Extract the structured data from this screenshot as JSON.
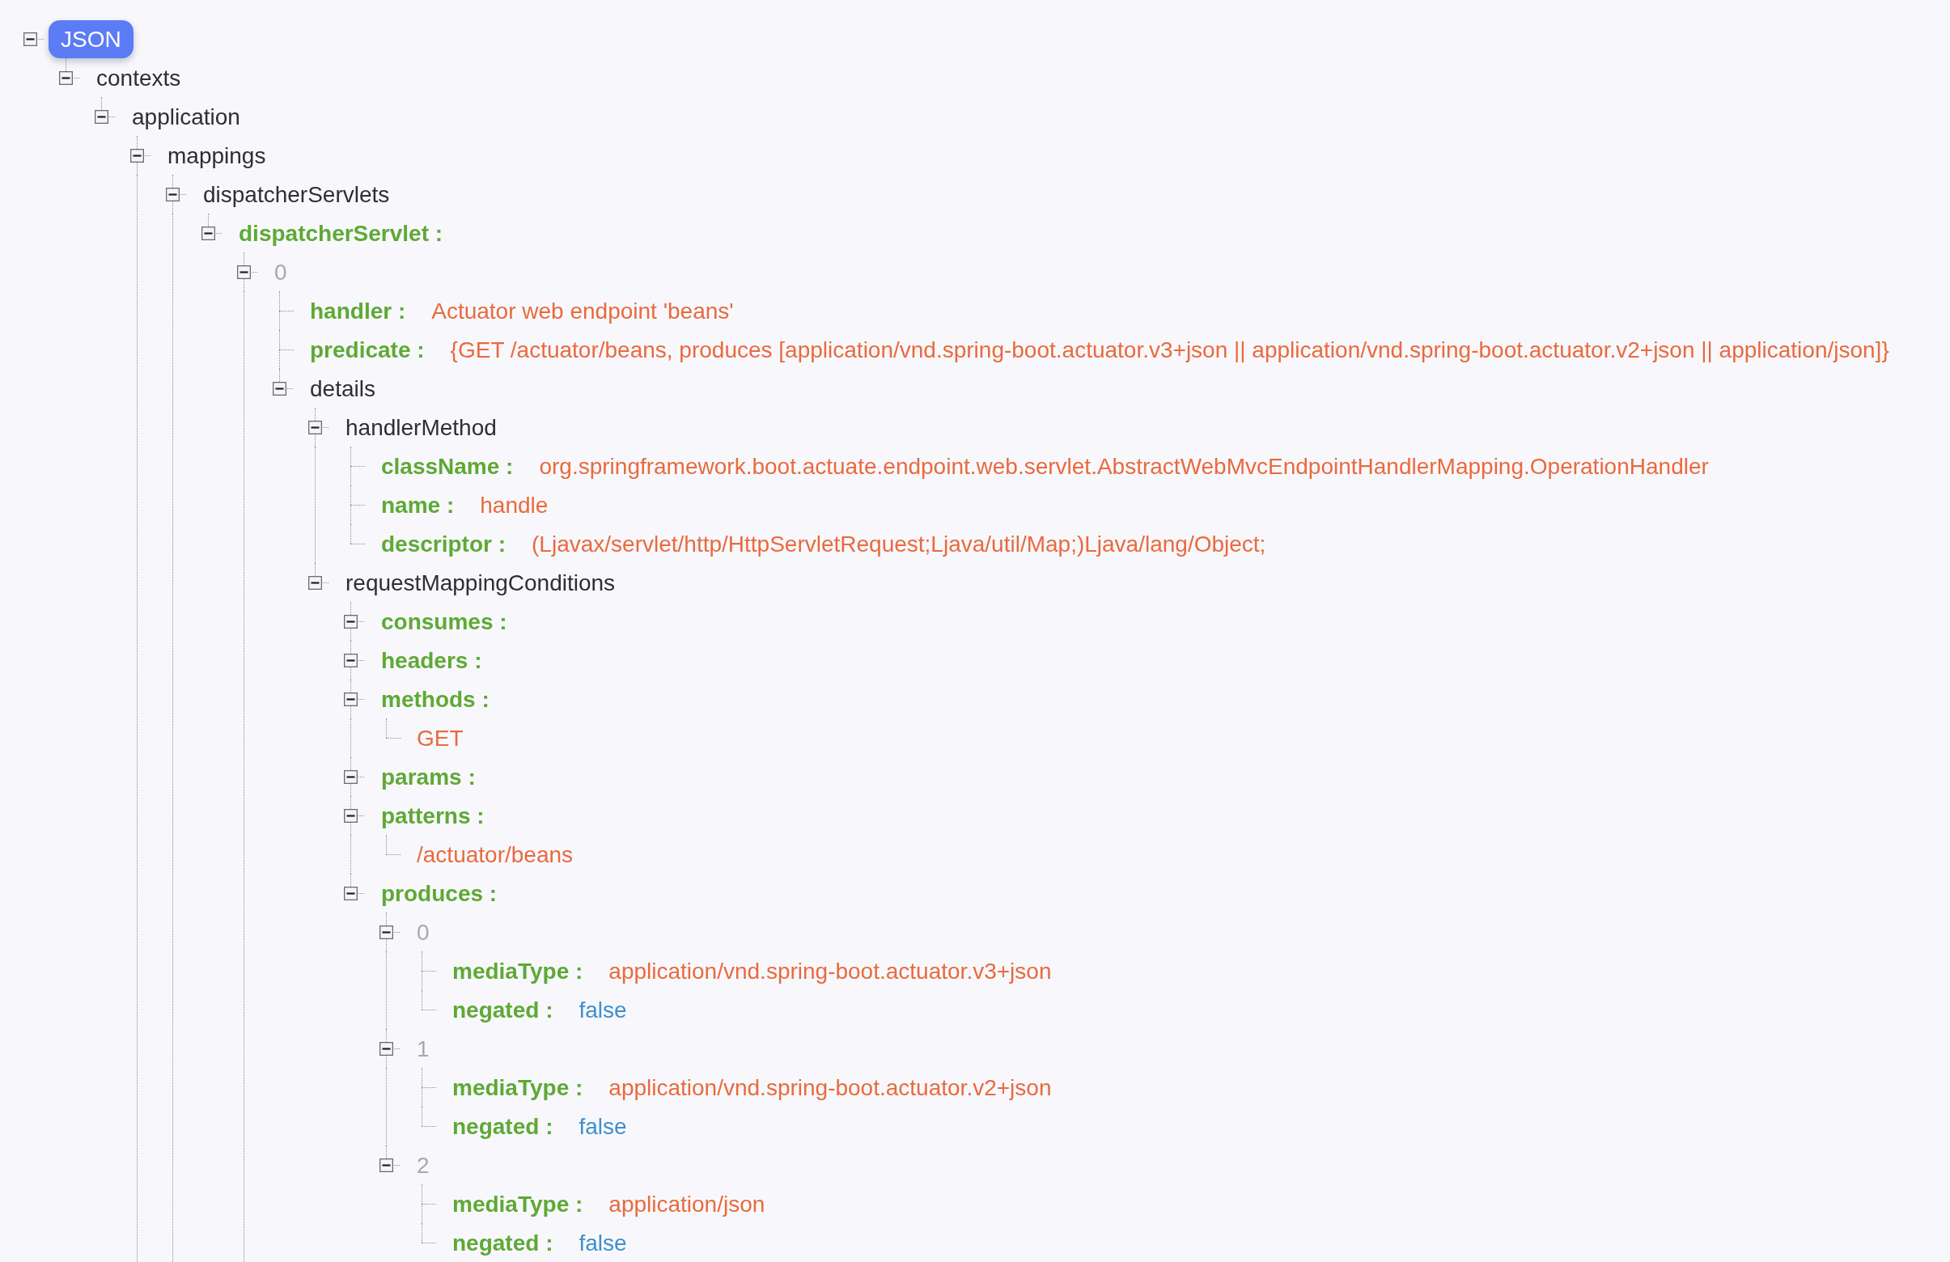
{
  "tree": {
    "kind": "object",
    "label": "JSON",
    "selected": true,
    "expanded": true,
    "children_continue": false,
    "children": [
      {
        "kind": "object",
        "label": "contexts",
        "selected": false,
        "expanded": true,
        "children_continue": false,
        "children": [
          {
            "kind": "object",
            "label": "application",
            "selected": false,
            "expanded": true,
            "children_continue": true,
            "children": [
              {
                "kind": "object",
                "label": "mappings",
                "selected": false,
                "expanded": true,
                "children_continue": true,
                "children": [
                  {
                    "kind": "object",
                    "label": "dispatcherServlets",
                    "selected": false,
                    "expanded": true,
                    "children_continue": false,
                    "children": [
                      {
                        "kind": "array",
                        "label": "dispatcherServlet :",
                        "selected": false,
                        "expanded": true,
                        "children_continue": true,
                        "children": [
                          {
                            "kind": "index",
                            "label": "0",
                            "selected": false,
                            "expanded": true,
                            "children_continue": false,
                            "children": [
                              {
                                "kind": "string",
                                "label": "handler :",
                                "value": "Actuator web endpoint 'beans'",
                                "selected": false
                              },
                              {
                                "kind": "string",
                                "label": "predicate :",
                                "value": "{GET /actuator/beans, produces [application/vnd.spring-boot.actuator.v3+json || application/vnd.spring-boot.actuator.v2+json || application/json]}",
                                "selected": false
                              },
                              {
                                "kind": "object",
                                "label": "details",
                                "selected": false,
                                "expanded": true,
                                "children_continue": false,
                                "children": [
                                  {
                                    "kind": "object",
                                    "label": "handlerMethod",
                                    "selected": false,
                                    "expanded": true,
                                    "children_continue": false,
                                    "children": [
                                      {
                                        "kind": "string",
                                        "label": "className :",
                                        "value": "org.springframework.boot.actuate.endpoint.web.servlet.AbstractWebMvcEndpointHandlerMapping.OperationHandler",
                                        "selected": false
                                      },
                                      {
                                        "kind": "string",
                                        "label": "name :",
                                        "value": "handle",
                                        "selected": false
                                      },
                                      {
                                        "kind": "string",
                                        "label": "descriptor :",
                                        "value": "(Ljavax/servlet/http/HttpServletRequest;Ljava/util/Map;)Ljava/lang/Object;",
                                        "selected": false
                                      }
                                    ]
                                  },
                                  {
                                    "kind": "object",
                                    "label": "requestMappingConditions",
                                    "selected": false,
                                    "expanded": true,
                                    "children_continue": false,
                                    "children": [
                                      {
                                        "kind": "array",
                                        "label": "consumes :",
                                        "selected": false,
                                        "expanded": true
                                      },
                                      {
                                        "kind": "array",
                                        "label": "headers :",
                                        "selected": false,
                                        "expanded": true
                                      },
                                      {
                                        "kind": "array",
                                        "label": "methods :",
                                        "selected": false,
                                        "expanded": true,
                                        "children_continue": false,
                                        "children": [
                                          {
                                            "kind": "item",
                                            "value": "GET",
                                            "selected": false
                                          }
                                        ]
                                      },
                                      {
                                        "kind": "array",
                                        "label": "params :",
                                        "selected": false,
                                        "expanded": true
                                      },
                                      {
                                        "kind": "array",
                                        "label": "patterns :",
                                        "selected": false,
                                        "expanded": true,
                                        "children_continue": false,
                                        "children": [
                                          {
                                            "kind": "item",
                                            "value": "/actuator/beans",
                                            "selected": false
                                          }
                                        ]
                                      },
                                      {
                                        "kind": "array",
                                        "label": "produces :",
                                        "selected": false,
                                        "expanded": true,
                                        "children_continue": false,
                                        "children": [
                                          {
                                            "kind": "index",
                                            "label": "0",
                                            "selected": false,
                                            "expanded": true,
                                            "children_continue": false,
                                            "children": [
                                              {
                                                "kind": "string",
                                                "label": "mediaType :",
                                                "value": "application/vnd.spring-boot.actuator.v3+json",
                                                "selected": false
                                              },
                                              {
                                                "kind": "boolean",
                                                "label": "negated :",
                                                "value": "false",
                                                "selected": false
                                              }
                                            ]
                                          },
                                          {
                                            "kind": "index",
                                            "label": "1",
                                            "selected": false,
                                            "expanded": true,
                                            "children_continue": false,
                                            "children": [
                                              {
                                                "kind": "string",
                                                "label": "mediaType :",
                                                "value": "application/vnd.spring-boot.actuator.v2+json",
                                                "selected": false
                                              },
                                              {
                                                "kind": "boolean",
                                                "label": "negated :",
                                                "value": "false",
                                                "selected": false
                                              }
                                            ]
                                          },
                                          {
                                            "kind": "index",
                                            "label": "2",
                                            "selected": false,
                                            "expanded": true,
                                            "children_continue": false,
                                            "children": [
                                              {
                                                "kind": "string",
                                                "label": "mediaType :",
                                                "value": "application/json",
                                                "selected": false
                                              },
                                              {
                                                "kind": "boolean",
                                                "label": "negated :",
                                                "value": "false",
                                                "selected": false
                                              }
                                            ]
                                          }
                                        ]
                                      }
                                    ]
                                  }
                                ]
                              }
                            ]
                          }
                        ]
                      }
                    ]
                  }
                ]
              }
            ]
          }
        ]
      }
    ]
  }
}
